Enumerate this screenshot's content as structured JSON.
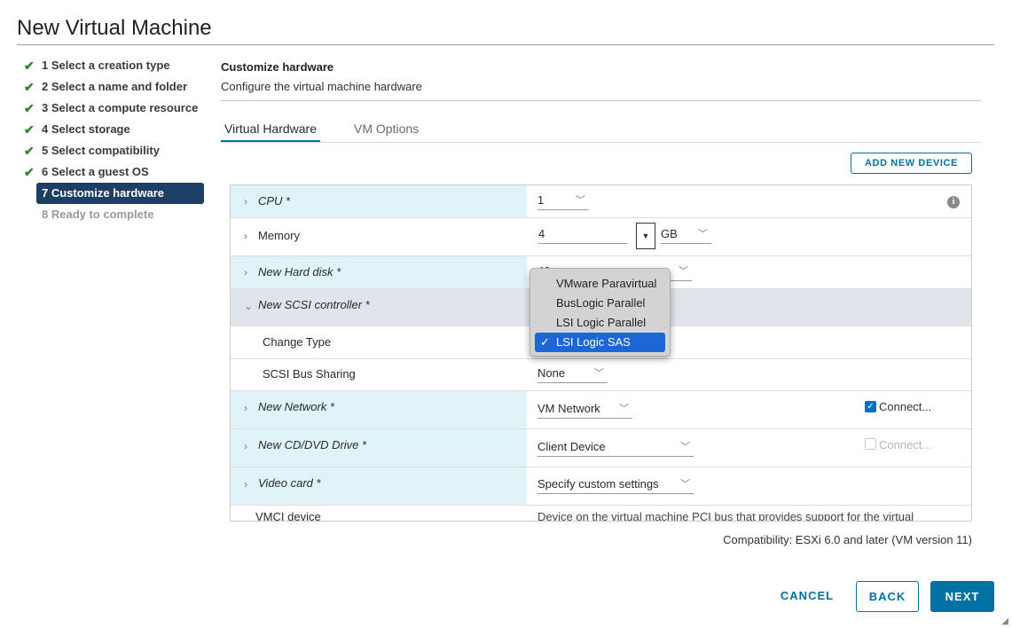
{
  "dialog": {
    "title": "New Virtual Machine"
  },
  "steps": [
    {
      "label": "1 Select a creation type",
      "state": "done"
    },
    {
      "label": "2 Select a name and folder",
      "state": "done"
    },
    {
      "label": "3 Select a compute resource",
      "state": "done"
    },
    {
      "label": "4 Select storage",
      "state": "done"
    },
    {
      "label": "5 Select compatibility",
      "state": "done"
    },
    {
      "label": "6 Select a guest OS",
      "state": "done"
    },
    {
      "label": "7 Customize hardware",
      "state": "active"
    },
    {
      "label": "8 Ready to complete",
      "state": "disabled"
    }
  ],
  "header": {
    "title": "Customize hardware",
    "subtitle": "Configure the virtual machine hardware"
  },
  "tabs": [
    {
      "label": "Virtual Hardware",
      "active": true
    },
    {
      "label": "VM Options",
      "active": false
    }
  ],
  "add_device_label": "ADD NEW DEVICE",
  "hardware": {
    "cpu": {
      "label": "CPU *",
      "value": "1"
    },
    "memory": {
      "label": "Memory",
      "value": "4",
      "unit": "GB"
    },
    "hard_disk": {
      "label": "New Hard disk *",
      "value_partial": "40"
    },
    "scsi": {
      "label": "New SCSI controller *",
      "change_type_label": "Change Type",
      "bus_sharing_label": "SCSI Bus Sharing",
      "bus_sharing_value": "None"
    },
    "network": {
      "label": "New Network *",
      "value": "VM Network",
      "connect_label": "Connect...",
      "connected": true
    },
    "cdrom": {
      "label": "New CD/DVD Drive *",
      "value": "Client Device",
      "connect_label": "Connect...",
      "connected": false
    },
    "video": {
      "label": "Video card *",
      "value": "Specify custom settings"
    },
    "vmci": {
      "label": "VMCI device",
      "description": "Device on the virtual machine PCI bus that provides support for the virtual"
    }
  },
  "scsi_type_dropdown": {
    "options": [
      "VMware Paravirtual",
      "BusLogic Parallel",
      "LSI Logic Parallel",
      "LSI Logic SAS"
    ],
    "selected": "LSI Logic SAS"
  },
  "compatibility": "Compatibility: ESXi 6.0 and later (VM version 11)",
  "footer": {
    "cancel": "CANCEL",
    "back": "BACK",
    "next": "NEXT"
  },
  "colors": {
    "accent": "#0072a3",
    "active_step": "#1d3f65",
    "row_highlight": "#dff3f8",
    "check": "#2e8b2e"
  }
}
